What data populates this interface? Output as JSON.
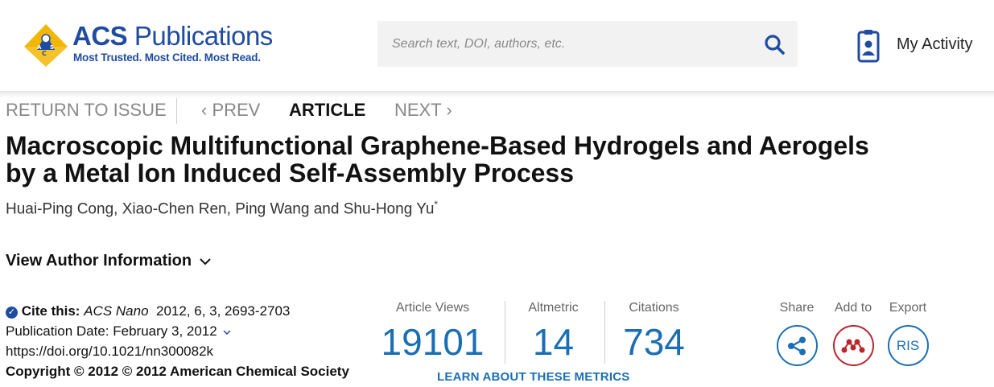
{
  "header": {
    "logo_title_bold": "ACS",
    "logo_title_rest": " Publications",
    "logo_tagline": "Most Trusted. Most Cited. Most Read.",
    "search_placeholder": "Search text, DOI, authors, etc.",
    "my_activity": "My Activity"
  },
  "nav": {
    "return": "RETURN TO ISSUE",
    "prev": "‹ PREV",
    "current": "ARTICLE",
    "next": "NEXT ›"
  },
  "article": {
    "title_line1": "Macroscopic Multifunctional Graphene-Based Hydrogels and Aerogels",
    "title_line2": "by a Metal Ion Induced Self-Assembly Process",
    "authors": [
      "Huai-Ping Cong",
      "Xiao-Chen Ren",
      "Ping Wang",
      "Shu-Hong Yu"
    ],
    "author_sep1": ",",
    "author_sep2": ",",
    "author_and": "and",
    "corresponding_mark": "*",
    "view_author_info": "View Author Information"
  },
  "cite": {
    "label": "Cite this:",
    "journal": "ACS Nano",
    "details": "2012, 6, 3, 2693-2703",
    "pub_date": "Publication Date: February 3, 2012",
    "doi": "https://doi.org/10.1021/nn300082k",
    "copyright": "Copyright © 2012 © 2012 American Chemical Society"
  },
  "metrics": {
    "views_label": "Article Views",
    "views_value": "19101",
    "altmetric_label": "Altmetric",
    "altmetric_value": "14",
    "citations_label": "Citations",
    "citations_value": "734",
    "learn_more": "LEARN ABOUT THESE METRICS"
  },
  "actions": {
    "share_label": "Share",
    "add_label": "Add to",
    "export_label": "Export",
    "export_button": "RIS"
  },
  "colors": {
    "brand_blue": "#1f4ca1",
    "metric_blue": "#1a6fb4",
    "mendeley_red": "#b8272c"
  },
  "icons": [
    "acs-logo-icon",
    "search-icon",
    "my-activity-icon",
    "check-icon",
    "chevron-down-icon",
    "share-icon",
    "mendeley-icon"
  ]
}
